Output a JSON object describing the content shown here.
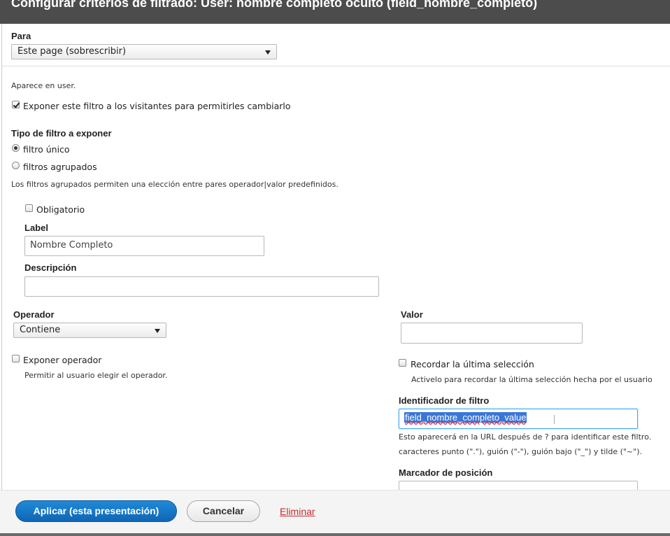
{
  "window": {
    "title": "Configurar criterios de filtrado: User: nombre completo oculto (field_nombre_completo)"
  },
  "para": {
    "label": "Para",
    "selected": "Este page (sobrescribir)"
  },
  "appears_in": "Aparece en user.",
  "expose_filter": {
    "label": "Exponer este filtro a los visitantes para permitirles cambiarlo",
    "checked": true
  },
  "filter_type": {
    "heading": "Tipo de filtro a exponer",
    "options": [
      "filtro único",
      "filtros agrupados"
    ],
    "selected": 0,
    "help": "Los filtros agrupados permiten una elección entre pares operador|valor predefinidos."
  },
  "required": {
    "label": "Obligatorio",
    "checked": false
  },
  "label_field": {
    "label": "Label",
    "value": "Nombre Completo"
  },
  "description_field": {
    "label": "Descripción",
    "value": ""
  },
  "operator": {
    "label": "Operador",
    "selected": "Contiene"
  },
  "value_field": {
    "label": "Valor",
    "value": ""
  },
  "expose_operator": {
    "label": "Exponer operador",
    "checked": false,
    "help": "Permitir al usuario elegir el operador."
  },
  "remember": {
    "label": "Recordar la última selección",
    "checked": false,
    "help": "Activelo para recordar la última selección hecha por el usuario"
  },
  "identifier": {
    "label": "Identificador de filtro",
    "value": "field_nombre_completo_value",
    "help1": "Esto aparecerá en la URL después de ? para identificar este filtro.",
    "help2": "caracteres punto (\".\"), guión (\"-\"), guión bajo (\"_\") y tilde (\"~\")."
  },
  "placeholder": {
    "label": "Marcador de posición"
  },
  "footer": {
    "apply_label": "Aplicar (esta presentación)",
    "cancel_label": "Cancelar",
    "delete_label": "Eliminar"
  },
  "colors": {
    "primary_button": "#0f66b5",
    "delete_link": "#c72a2a",
    "titlebar": "#4c4c4c"
  }
}
